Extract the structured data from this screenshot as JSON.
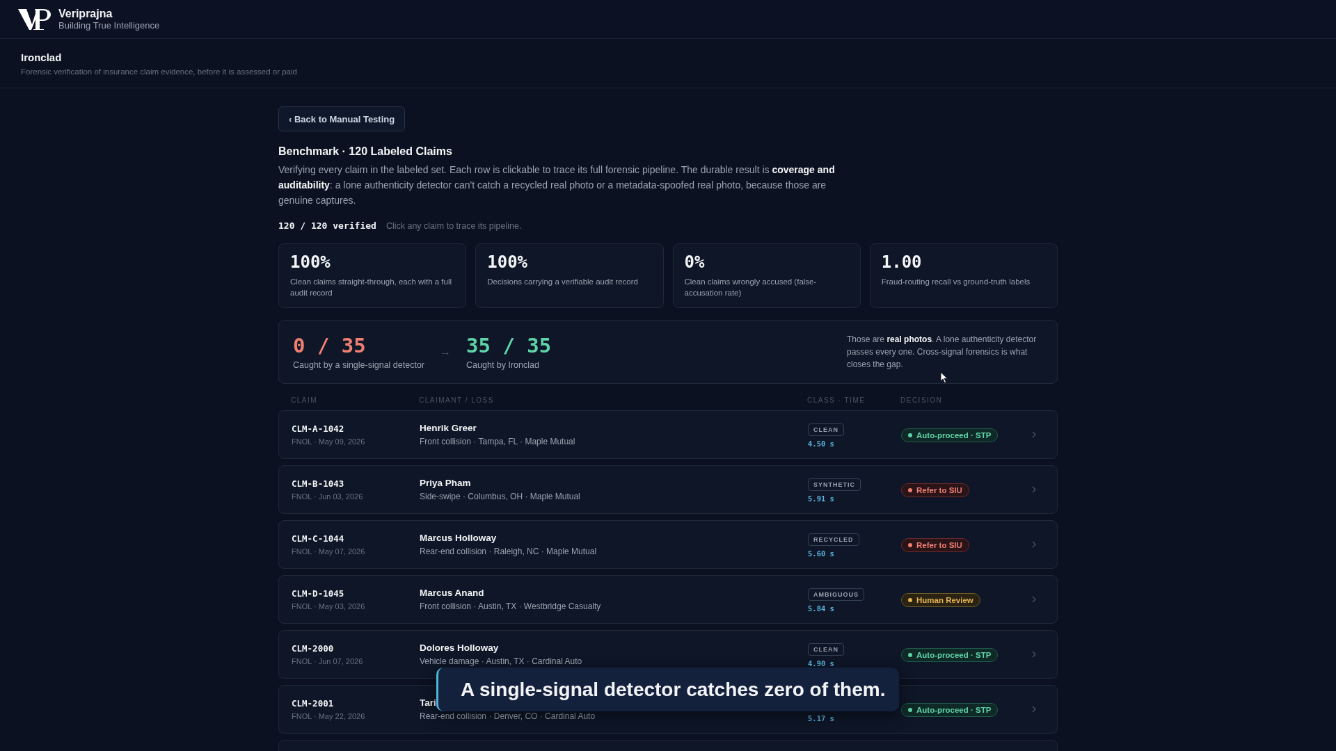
{
  "brand": {
    "name": "Veriprajna",
    "tagline": "Building True Intelligence"
  },
  "product": {
    "title": "Ironclad",
    "subtitle": "Forensic verification of insurance claim evidence, before it is assessed or paid"
  },
  "back_button": "‹ Back to Manual Testing",
  "heading": "Benchmark · 120 Labeled Claims",
  "intro": "Verifying every claim in the labeled set. Each row is clickable to trace its full forensic pipeline. The durable result is **coverage and auditability**: a lone authenticity detector can't catch a recycled real photo or a metadata-spoofed real photo, because those are genuine captures.",
  "verified": {
    "count": "120 / 120 verified",
    "hint": "Click any claim to trace its pipeline."
  },
  "stats": [
    {
      "value": "100%",
      "label": "Clean claims straight-through, each with a full audit record"
    },
    {
      "value": "100%",
      "label": "Decisions carrying a verifiable audit record"
    },
    {
      "value": "0%",
      "label": "Clean claims wrongly accused (false-accusation rate)"
    },
    {
      "value": "1.00",
      "label": "Fraud-routing recall vs ground-truth labels"
    }
  ],
  "comparison": {
    "before": {
      "value": "0 / 35",
      "label": "Caught by a single-signal detector"
    },
    "arrow": "→",
    "after": {
      "value": "35 / 35",
      "label": "Caught by Ironclad"
    },
    "note": "Those are **real photos**. A lone authenticity detector passes every one. Cross-signal forensics is what closes the gap."
  },
  "table": {
    "columns": [
      "CLAIM",
      "CLAIMANT / LOSS",
      "CLASS · TIME",
      "DECISION"
    ],
    "rows": [
      {
        "claim": "CLM-A-1042",
        "date": "FNOL · May 09, 2026",
        "claimant": "Henrik Greer",
        "loss": "Front collision · Tampa, FL · Maple Mutual",
        "class": "CLEAN",
        "time": "4.50 s",
        "decision": {
          "kind": "auto",
          "label": "Auto-proceed · STP"
        }
      },
      {
        "claim": "CLM-B-1043",
        "date": "FNOL · Jun 03, 2026",
        "claimant": "Priya Pham",
        "loss": "Side-swipe · Columbus, OH · Maple Mutual",
        "class": "SYNTHETIC",
        "time": "5.91 s",
        "decision": {
          "kind": "refer",
          "label": "Refer to SIU"
        }
      },
      {
        "claim": "CLM-C-1044",
        "date": "FNOL · May 07, 2026",
        "claimant": "Marcus Holloway",
        "loss": "Rear-end collision · Raleigh, NC · Maple Mutual",
        "class": "RECYCLED",
        "time": "5.60 s",
        "decision": {
          "kind": "refer",
          "label": "Refer to SIU"
        }
      },
      {
        "claim": "CLM-D-1045",
        "date": "FNOL · May 03, 2026",
        "claimant": "Marcus Anand",
        "loss": "Front collision · Austin, TX · Westbridge Casualty",
        "class": "AMBIGUOUS",
        "time": "5.84 s",
        "decision": {
          "kind": "review",
          "label": "Human Review"
        }
      },
      {
        "claim": "CLM-2000",
        "date": "FNOL · Jun 07, 2026",
        "claimant": "Dolores Holloway",
        "loss": "Vehicle damage · Austin, TX · Cardinal Auto",
        "class": "CLEAN",
        "time": "4.90 s",
        "decision": {
          "kind": "auto",
          "label": "Auto-proceed · STP"
        }
      },
      {
        "claim": "CLM-2001",
        "date": "FNOL · May 22, 2026",
        "claimant": "Tari",
        "loss": "Rear-end collision · Denver, CO · Cardinal Auto",
        "time": "5.17 s",
        "decision": {
          "kind": "auto",
          "label": "Auto-proceed · STP"
        }
      },
      {}
    ]
  },
  "caption": "A single-signal detector catches zero of them."
}
